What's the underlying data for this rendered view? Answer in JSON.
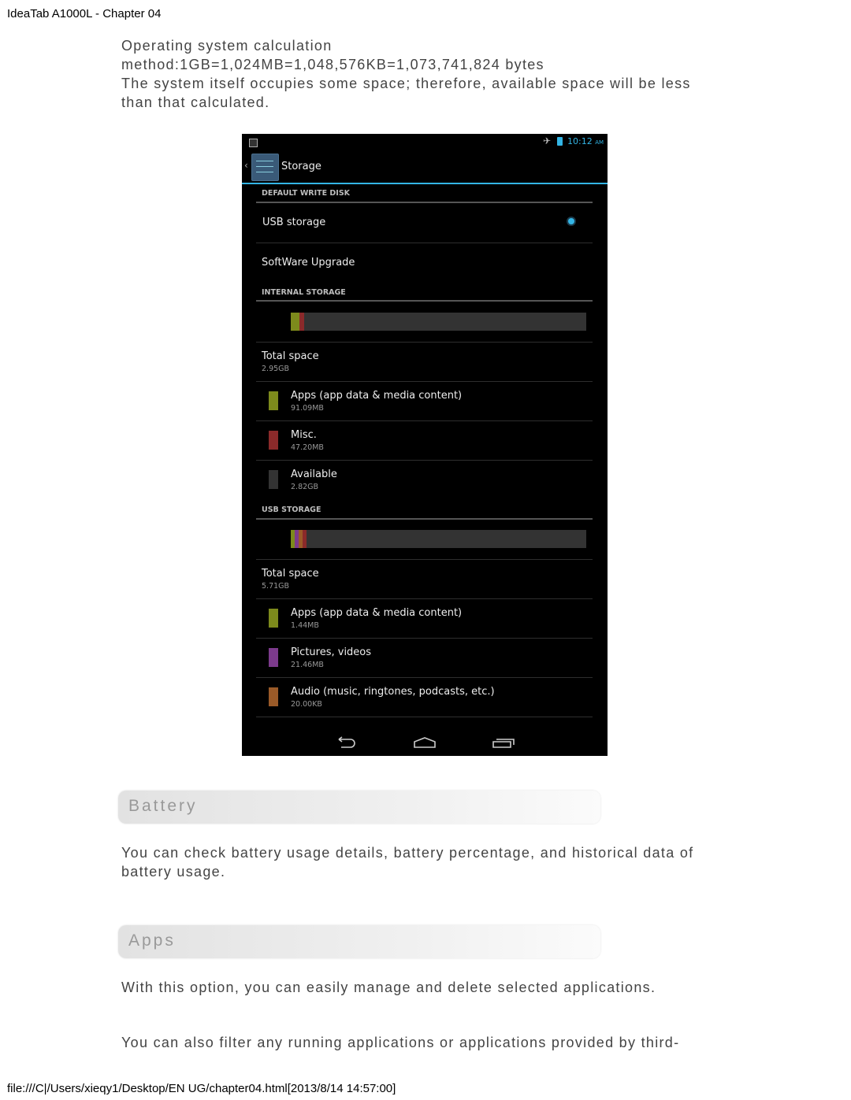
{
  "header": {
    "title": "IdeaTab A1000L - Chapter 04"
  },
  "footer": {
    "path": "file:///C|/Users/xieqy1/Desktop/EN UG/chapter04.html[2013/8/14 14:57:00]"
  },
  "intro": {
    "line1": "Operating system calculation",
    "line2": "method:1GB=1,024MB=1,048,576KB=1,073,741,824 bytes",
    "line3": "The system itself occupies some space; therefore, available space will be less than that calculated."
  },
  "phone": {
    "status": {
      "time": "10:12",
      "ampm": "AM",
      "icons": [
        "picture-icon",
        "airplane-mode-icon",
        "battery-icon"
      ]
    },
    "action_bar": {
      "title": "Storage",
      "icon": "settings-sliders-icon"
    },
    "default_write_disk": {
      "caption": "DEFAULT WRITE DISK",
      "options": [
        {
          "label": "USB storage",
          "selected": true
        },
        {
          "label": "SoftWare Upgrade",
          "selected": false
        }
      ]
    },
    "internal": {
      "caption": "INTERNAL STORAGE",
      "usage_fractions": {
        "apps": 0.03,
        "misc": 0.016
      },
      "total_label": "Total space",
      "total_value": "2.95GB",
      "items": [
        {
          "label": "Apps (app data & media content)",
          "value": "91.09MB",
          "color": "#7d8a1c"
        },
        {
          "label": "Misc.",
          "value": "47.20MB",
          "color": "#8b2a2a"
        },
        {
          "label": "Available",
          "value": "2.82GB",
          "color": "#333333"
        }
      ]
    },
    "usb": {
      "caption": "USB STORAGE",
      "total_label": "Total space",
      "total_value": "5.71GB",
      "items": [
        {
          "label": "Apps (app data & media content)",
          "value": "1.44MB",
          "color": "#7d8a1c"
        },
        {
          "label": "Pictures, videos",
          "value": "21.46MB",
          "color": "#7c3a8c"
        },
        {
          "label": "Audio (music, ringtones, podcasts, etc.)",
          "value": "20.00KB",
          "color": "#9a5a28"
        }
      ]
    },
    "nav": [
      "back-icon",
      "home-icon",
      "recent-apps-icon"
    ],
    "accent": "#33b5e5"
  },
  "battery": {
    "heading": "Battery",
    "text": "You can check battery usage details, battery percentage, and historical data of battery usage."
  },
  "apps": {
    "heading": "Apps",
    "text1": "With this option, you can easily manage and delete selected applications.",
    "text2": "You can also filter any running applications or applications provided by third-"
  }
}
